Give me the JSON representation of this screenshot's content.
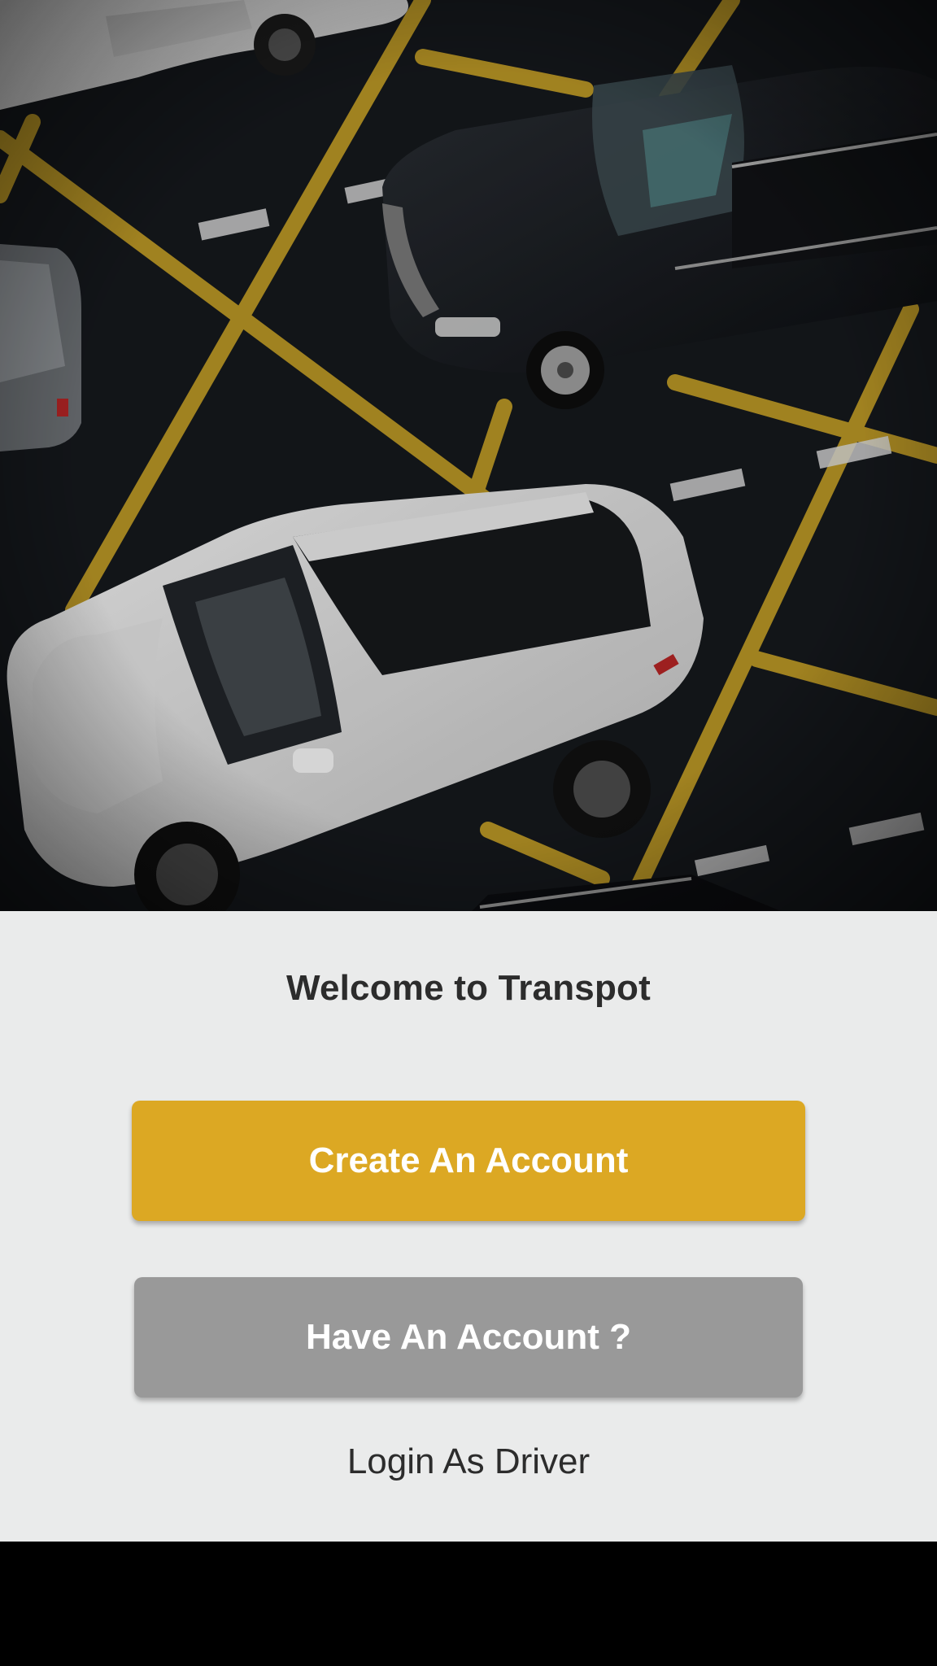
{
  "app": {
    "welcome_title": "Welcome to Transpot"
  },
  "actions": {
    "create_account_label": "Create An Account",
    "have_account_label": "Have An Account ?",
    "driver_login_label": "Login As Driver"
  },
  "hero_image": {
    "description_icon": "parking-lot-cars-photo"
  },
  "colors": {
    "accent": "#dca823",
    "secondary_button": "#999999",
    "panel_background": "#eaebeb",
    "text_dark": "#2c2c2c"
  }
}
